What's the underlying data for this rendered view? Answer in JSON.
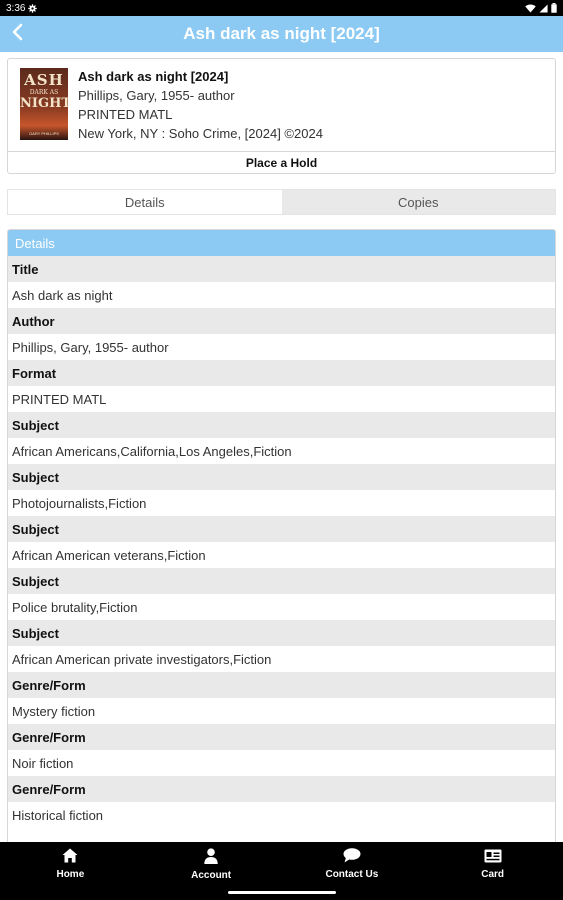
{
  "status_bar": {
    "time": "3:36"
  },
  "app_bar": {
    "title": "Ash dark as night [2024]"
  },
  "book": {
    "title": "Ash dark as night [2024]",
    "author": "Phillips, Gary, 1955- author",
    "format": "PRINTED MATL",
    "publisher": "New York, NY : Soho Crime, [2024] ©2024",
    "cover": {
      "line1": "ASH",
      "line2": "DARK AS",
      "line3": "NIGHT",
      "line4": "GARY PHILLIPS"
    },
    "hold_label": "Place a Hold"
  },
  "tabs": [
    {
      "label": "Details",
      "active": true
    },
    {
      "label": "Copies",
      "active": false
    }
  ],
  "details": {
    "header": "Details",
    "rows": [
      {
        "label": "Title",
        "value": "Ash dark as night"
      },
      {
        "label": "Author",
        "value": "Phillips, Gary, 1955- author"
      },
      {
        "label": "Format",
        "value": "PRINTED MATL"
      },
      {
        "label": "Subject",
        "value": "African Americans,California,Los Angeles,Fiction"
      },
      {
        "label": "Subject",
        "value": "Photojournalists,Fiction"
      },
      {
        "label": "Subject",
        "value": "African American veterans,Fiction"
      },
      {
        "label": "Subject",
        "value": "Police brutality,Fiction"
      },
      {
        "label": "Subject",
        "value": "African American private investigators,Fiction"
      },
      {
        "label": "Genre/Form",
        "value": "Mystery fiction"
      },
      {
        "label": "Genre/Form",
        "value": "Noir fiction"
      },
      {
        "label": "Genre/Form",
        "value": "Historical fiction"
      }
    ]
  },
  "bottom_nav": [
    {
      "label": "Home",
      "icon": "home-icon"
    },
    {
      "label": "Account",
      "icon": "account-icon"
    },
    {
      "label": "Contact Us",
      "icon": "chat-icon"
    },
    {
      "label": "Card",
      "icon": "card-icon"
    }
  ],
  "colors": {
    "accent": "#8ccaf3",
    "row_label_bg": "#e9e9e9",
    "nav_bg": "#000000"
  }
}
